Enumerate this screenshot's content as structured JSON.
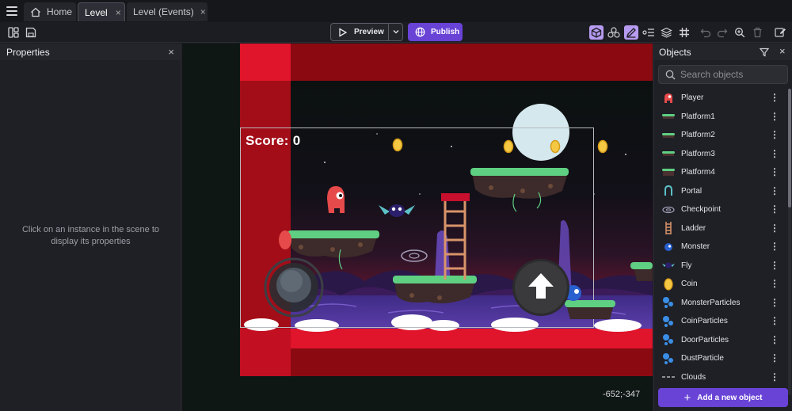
{
  "tabs": [
    {
      "label": "Home",
      "icon": "home-icon"
    },
    {
      "label": "Level",
      "close": "×"
    },
    {
      "label": "Level (Events)",
      "close": "×"
    }
  ],
  "toolbar": {
    "preview_label": "Preview",
    "publish_label": "Publish"
  },
  "properties": {
    "title": "Properties",
    "close": "×",
    "empty_message": "Click on an instance in the scene to display its properties"
  },
  "scene": {
    "score_text": "Score: 0",
    "coords": "-652;-347"
  },
  "objects": {
    "title": "Objects",
    "close": "×",
    "search_placeholder": "Search objects",
    "items": [
      {
        "name": "Player",
        "icon": "player-icon"
      },
      {
        "name": "Platform1",
        "icon": "platform-icon"
      },
      {
        "name": "Platform2",
        "icon": "platform-icon"
      },
      {
        "name": "Platform3",
        "icon": "platform-icon"
      },
      {
        "name": "Platform4",
        "icon": "platform-icon"
      },
      {
        "name": "Portal",
        "icon": "portal-icon"
      },
      {
        "name": "Checkpoint",
        "icon": "checkpoint-icon"
      },
      {
        "name": "Ladder",
        "icon": "ladder-icon"
      },
      {
        "name": "Monster",
        "icon": "monster-icon"
      },
      {
        "name": "Fly",
        "icon": "fly-icon"
      },
      {
        "name": "Coin",
        "icon": "coin-icon"
      },
      {
        "name": "MonsterParticles",
        "icon": "particles-icon"
      },
      {
        "name": "CoinParticles",
        "icon": "particles-icon"
      },
      {
        "name": "DoorParticles",
        "icon": "particles-icon"
      },
      {
        "name": "DustParticle",
        "icon": "particles-icon"
      },
      {
        "name": "Clouds",
        "icon": "clouds-icon"
      }
    ],
    "more_glyph": "⋮",
    "add_button": "Add a new object",
    "add_plus": "+"
  },
  "colors": {
    "accent": "#6843d6",
    "scene_bg": "#0f1715",
    "scene_red": "#8b0a12",
    "grass": "#5fcf82"
  }
}
